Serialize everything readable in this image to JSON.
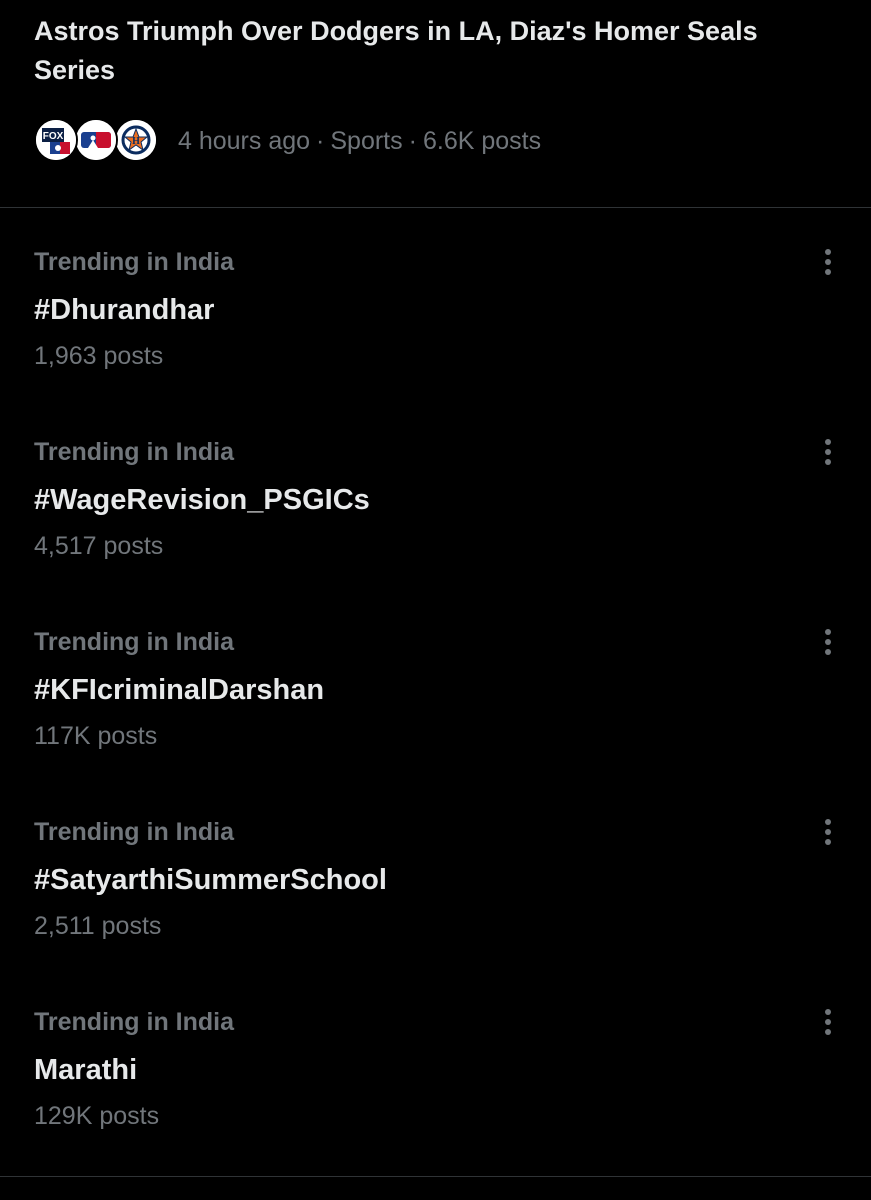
{
  "news": {
    "headline": "Astros Triumph Over Dodgers in LA, Diaz's Homer Seals Series",
    "time": "4 hours ago",
    "category": "Sports",
    "posts": "6.6K posts",
    "separator": "·",
    "avatars": [
      "fox-sports-logo",
      "mlb-logo",
      "astros-logo"
    ]
  },
  "trends": [
    {
      "context": "Trending in India",
      "name": "#Dhurandhar",
      "count": "1,963 posts"
    },
    {
      "context": "Trending in India",
      "name": "#WageRevision_PSGICs",
      "count": "4,517 posts"
    },
    {
      "context": "Trending in India",
      "name": "#KFIcriminalDarshan",
      "count": "117K posts"
    },
    {
      "context": "Trending in India",
      "name": "#SatyarthiSummerSchool",
      "count": "2,511 posts"
    },
    {
      "context": "Trending in India",
      "name": "Marathi",
      "count": "129K posts"
    }
  ],
  "colors": {
    "background": "#000000",
    "primary_text": "#e7e9ea",
    "secondary_text": "#71767b",
    "divider": "#2f3336"
  },
  "icons": {
    "more": "more-vertical-icon"
  }
}
